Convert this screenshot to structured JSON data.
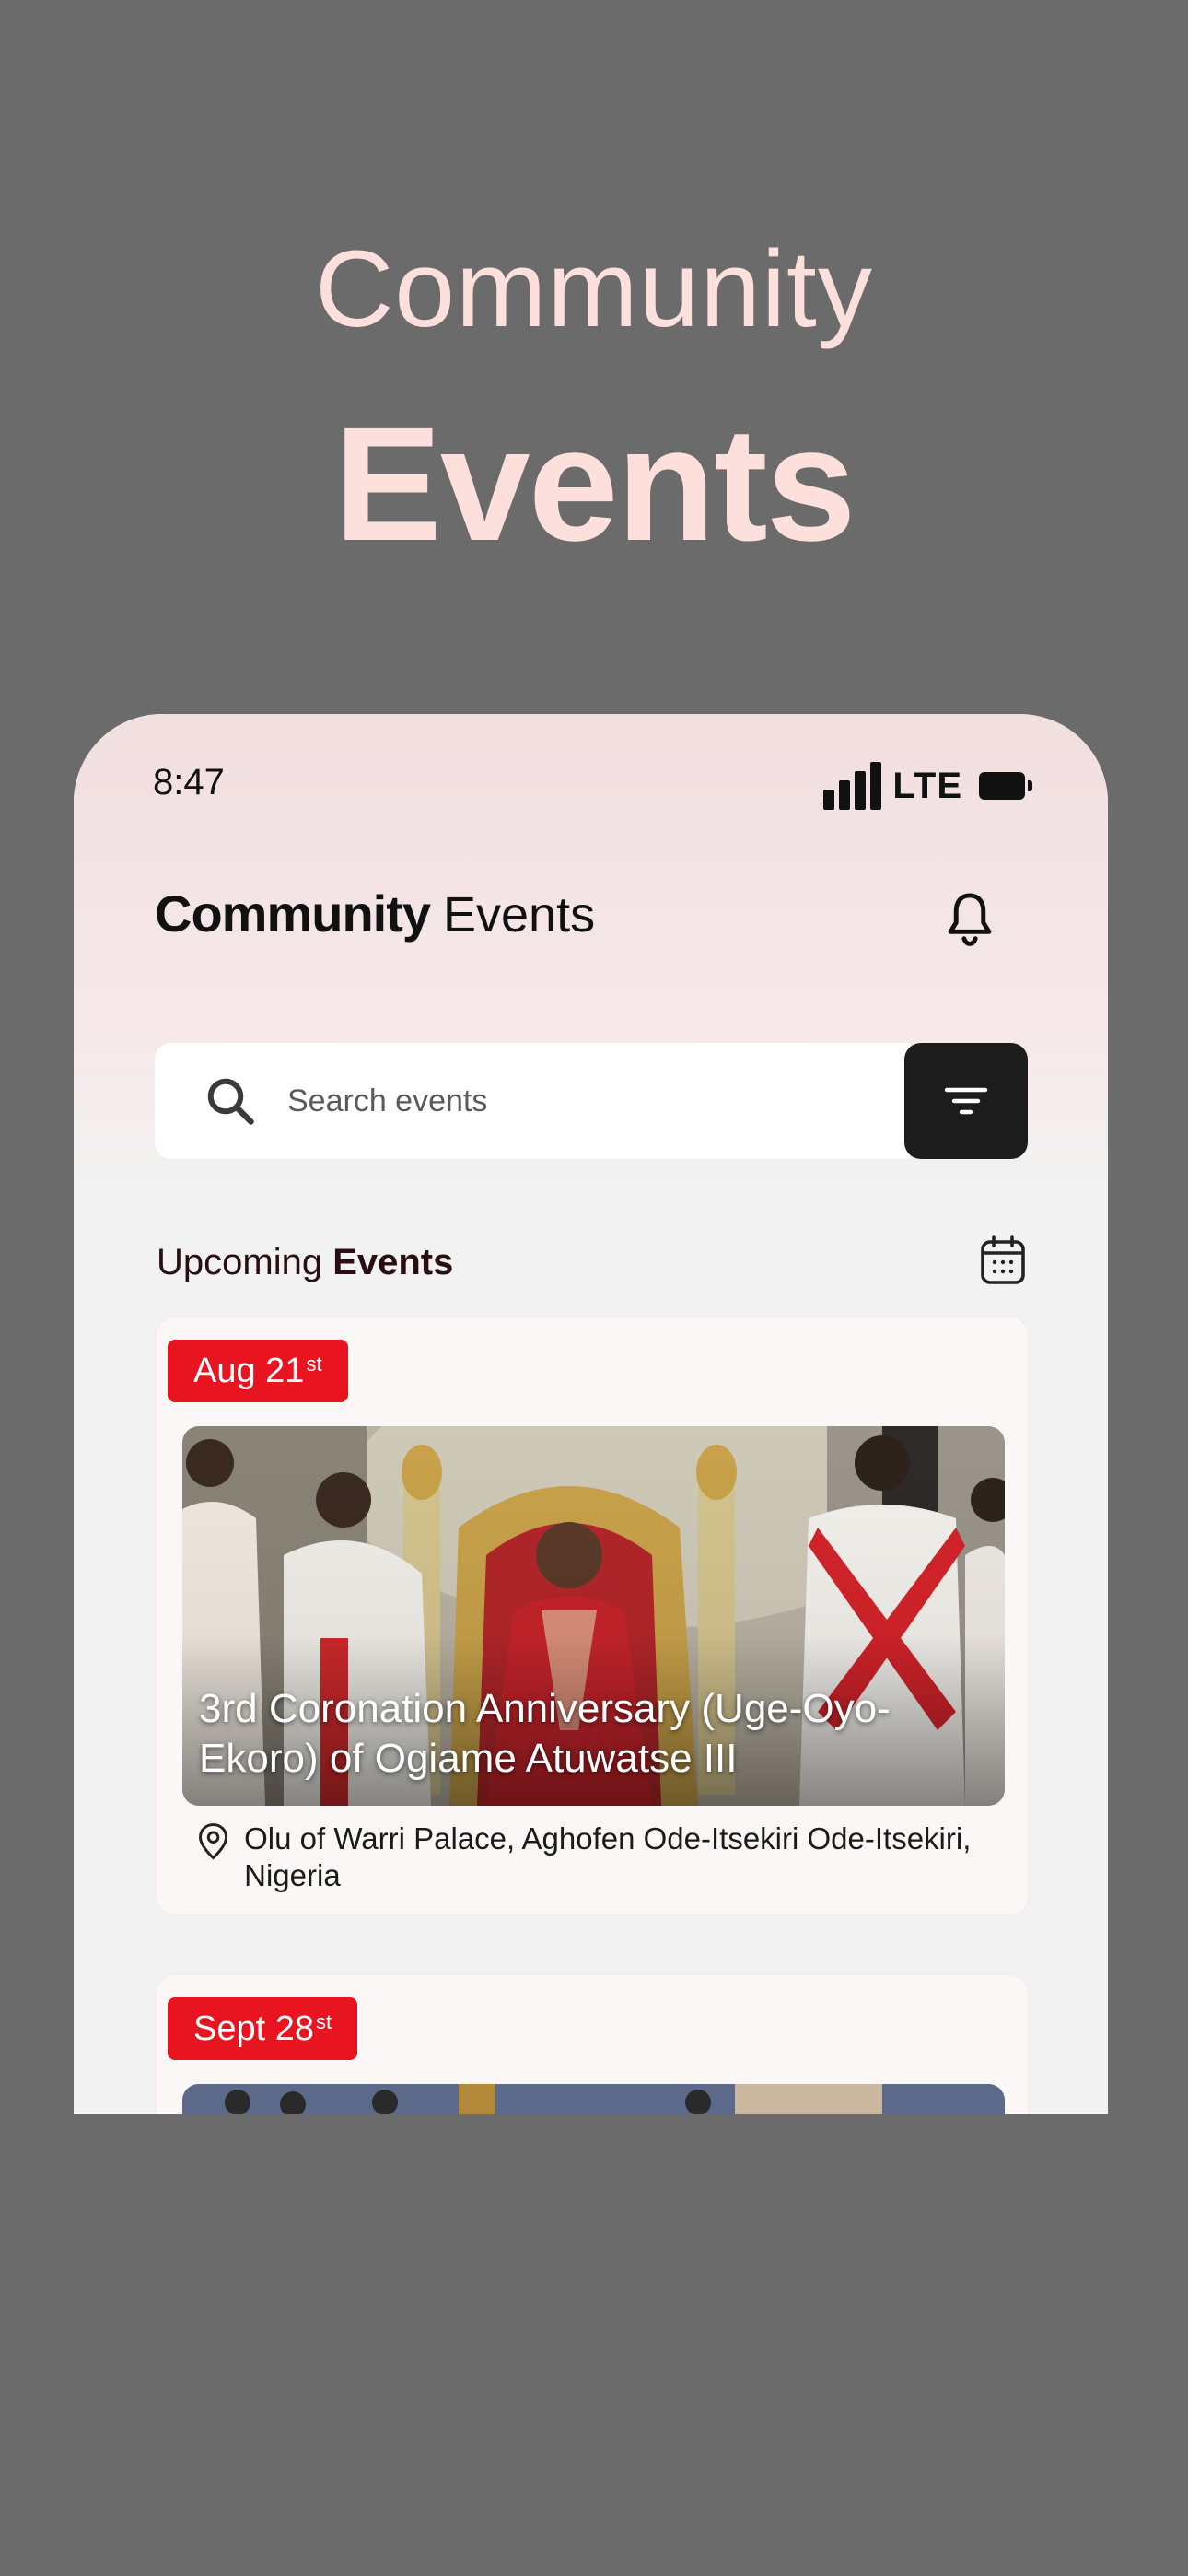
{
  "promo": {
    "line1": "Community",
    "line2": "Events"
  },
  "status_bar": {
    "time": "8:47",
    "network": "LTE"
  },
  "header": {
    "brand": "Community",
    "title_suffix": "Events",
    "bell_icon": "bell-icon"
  },
  "search": {
    "placeholder": "Search events",
    "icon": "search-icon",
    "filter_icon": "filter-icon"
  },
  "section": {
    "label_regular": "Upcoming",
    "label_bold": "Events",
    "calendar_icon": "calendar-icon"
  },
  "events": [
    {
      "date": "Aug 21",
      "date_suffix": "st",
      "title": "3rd Coronation Anniversary (Uge-Oyo-Ekoro) of Ogiame Atuwatse III",
      "location": "Olu of Warri Palace, Aghofen Ode-Itsekiri Ode-Itsekiri, Nigeria",
      "location_icon": "location-pin-icon"
    },
    {
      "date": "Sept 28",
      "date_suffix": "st"
    }
  ],
  "colors": {
    "background": "#6b6b6b",
    "promo_text": "#fde0dc",
    "badge": "#e8141f",
    "filter_button": "#1c1c1c"
  }
}
